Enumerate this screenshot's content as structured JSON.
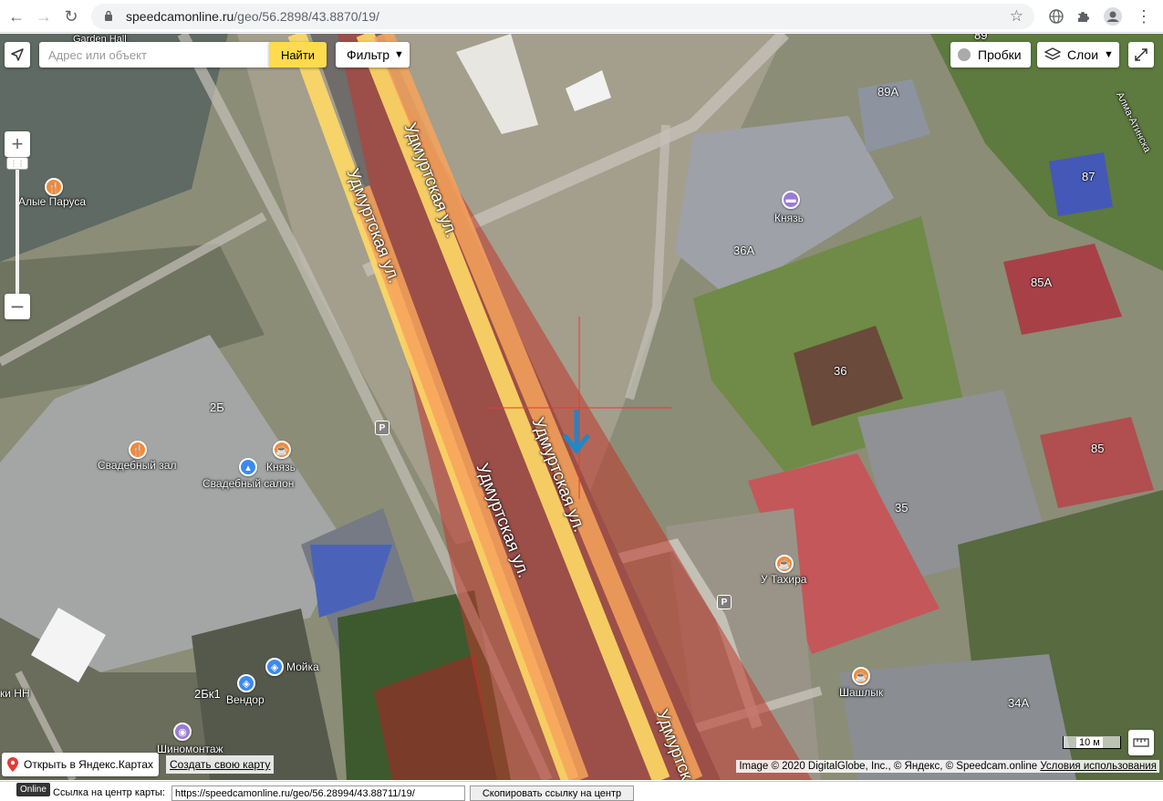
{
  "browser": {
    "url_domain": "speedcamonline.ru",
    "url_path": "/geo/56.2898/43.8870/19/"
  },
  "map_controls": {
    "search_placeholder": "Адрес или объект",
    "find_label": "Найти",
    "filter_label": "Фильтр",
    "traffic_label": "Пробки",
    "layers_label": "Слои",
    "zoom_in": "+",
    "zoom_out": "−"
  },
  "map_labels": {
    "streets": [
      "Удмуртская ул.",
      "Удмуртская ул.",
      "Удмуртская ул.",
      "Удмуртская ул.",
      "Удмуртская"
    ],
    "alma_atinskaya": "Алма-Атинска",
    "places": [
      {
        "name": "Garden Hall"
      },
      {
        "name": "Алые Паруса",
        "icon": "fork-knife-icon",
        "color": "#f08a3c"
      },
      {
        "name": "Князь",
        "icon": "bed-icon",
        "color": "#9b7bd4"
      },
      {
        "name": "Свадебный зал",
        "icon": "fork-knife-icon",
        "color": "#f08a3c"
      },
      {
        "name": "Князь",
        "icon": "cup-icon",
        "color": "#f08a3c"
      },
      {
        "name": "Свадебный салон",
        "icon": "shirt-icon",
        "color": "#3c8af0"
      },
      {
        "name": "У Тахира",
        "icon": "cup-icon",
        "color": "#f08a3c"
      },
      {
        "name": "Мойка",
        "icon": "car-icon",
        "color": "#3c8af0"
      },
      {
        "name": "Вендор",
        "icon": "car-icon",
        "color": "#3c8af0"
      },
      {
        "name": "Шиномонтаж",
        "icon": "tire-icon",
        "color": "#9b7bd4"
      },
      {
        "name": "Шашлык",
        "icon": "cup-icon",
        "color": "#f08a3c"
      },
      {
        "name": "ки НН"
      }
    ],
    "house_numbers": [
      "89",
      "89А",
      "87",
      "36А",
      "85А",
      "36",
      "85",
      "35",
      "2Б",
      "2Бк1",
      "34А"
    ]
  },
  "bottom_bar": {
    "open_yandex": "Открыть в Яндекс.Картах",
    "create_map": "Создать свою карту",
    "copyright": "Image © 2020 DigitalGlobe, Inc., © Яндекс, © Speedcam.online",
    "terms": "Условия использования",
    "scale": "10 м"
  },
  "footer": {
    "badge": "Online",
    "link_label": "Ссылка на центр карты:",
    "link_value": "https://speedcamonline.ru/geo/56.28994/43.88711/19/",
    "copy_button": "Скопировать ссылку на центр"
  },
  "colors": {
    "camera_zone": "#c0392b",
    "road_orange": "#f7a35c",
    "road_yellow": "#ffd966",
    "direction_arrow": "#1e88c8",
    "crosshair": "#e53935",
    "find_button": "#ffdb4d"
  }
}
